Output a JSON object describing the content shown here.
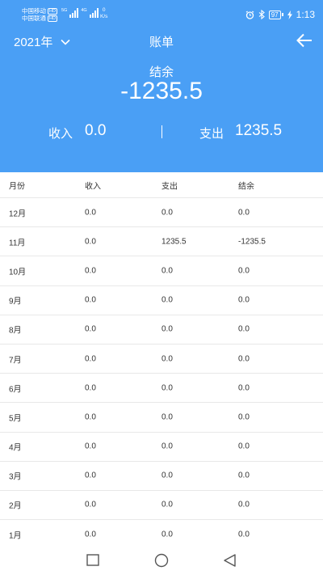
{
  "status_bar": {
    "carrier1": "中国移动",
    "carrier2": "中国联通",
    "hd": "HD",
    "net1": "5G",
    "net2": "4G",
    "speed_value": "0",
    "speed_unit": "K/s",
    "battery": "97",
    "time": "1:13"
  },
  "header": {
    "year": "2021年",
    "title": "账单",
    "balance_label": "结余",
    "balance_value": "-1235.5",
    "income_label": "收入",
    "income_value": "0.0",
    "expense_label": "支出",
    "expense_value": "1235.5"
  },
  "table": {
    "columns": [
      "月份",
      "收入",
      "支出",
      "结余"
    ],
    "rows": [
      [
        "12月",
        "0.0",
        "0.0",
        "0.0"
      ],
      [
        "11月",
        "0.0",
        "1235.5",
        "-1235.5"
      ],
      [
        "10月",
        "0.0",
        "0.0",
        "0.0"
      ],
      [
        "9月",
        "0.0",
        "0.0",
        "0.0"
      ],
      [
        "8月",
        "0.0",
        "0.0",
        "0.0"
      ],
      [
        "7月",
        "0.0",
        "0.0",
        "0.0"
      ],
      [
        "6月",
        "0.0",
        "0.0",
        "0.0"
      ],
      [
        "5月",
        "0.0",
        "0.0",
        "0.0"
      ],
      [
        "4月",
        "0.0",
        "0.0",
        "0.0"
      ],
      [
        "3月",
        "0.0",
        "0.0",
        "0.0"
      ],
      [
        "2月",
        "0.0",
        "0.0",
        "0.0"
      ],
      [
        "1月",
        "0.0",
        "0.0",
        "0.0"
      ]
    ]
  },
  "colors": {
    "accent": "#4a9ff5"
  }
}
